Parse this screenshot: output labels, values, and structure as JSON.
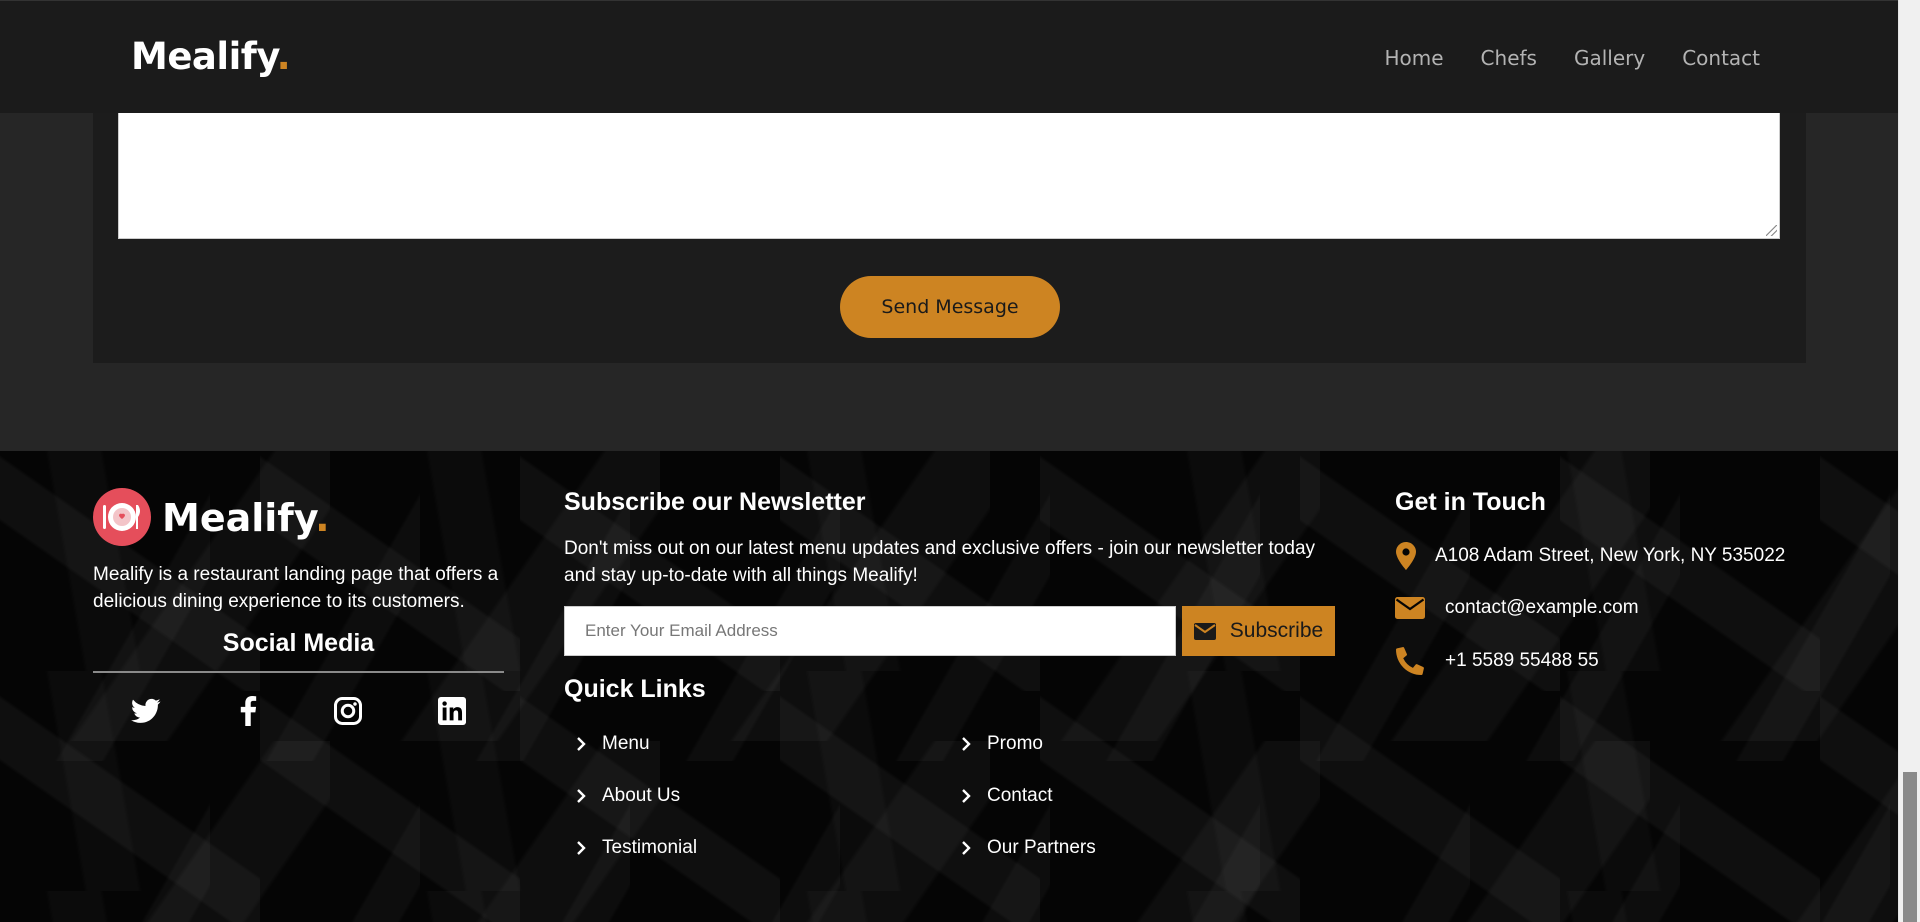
{
  "header": {
    "brand": "Mealify",
    "brand_dot": ".",
    "nav": [
      "Home",
      "Chefs",
      "Gallery",
      "Contact"
    ]
  },
  "form": {
    "message_value": "",
    "send_label": "Send Message"
  },
  "footer": {
    "brand": "Mealify",
    "brand_dot": ".",
    "description": "Mealify is a restaurant landing page that offers a delicious dining experience to its customers.",
    "social_title": "Social Media",
    "social_icons": [
      "twitter-icon",
      "facebook-icon",
      "instagram-icon",
      "linkedin-icon"
    ],
    "newsletter": {
      "title": "Subscribe our Newsletter",
      "text": "Don't miss out on our latest menu updates and exclusive offers - join our newsletter today and stay up-to-date with all things Mealify!",
      "email_placeholder": "Enter Your Email Address",
      "email_value": "",
      "subscribe_label": "Subscribe"
    },
    "quick_links": {
      "title": "Quick Links",
      "col1": [
        "Menu",
        "About Us",
        "Testimonial"
      ],
      "col2": [
        "Promo",
        "Contact",
        "Our Partners"
      ]
    },
    "contact": {
      "title": "Get in Touch",
      "address": "A108 Adam Street, New York, NY 535022",
      "email": "contact@example.com",
      "phone": "+1 5589 55488 55"
    }
  },
  "colors": {
    "accent": "#cd8422",
    "logo_red": "#e54e5b",
    "header_bg": "#1b1b1b",
    "page_bg": "#262626",
    "footer_bg": "#050505"
  }
}
